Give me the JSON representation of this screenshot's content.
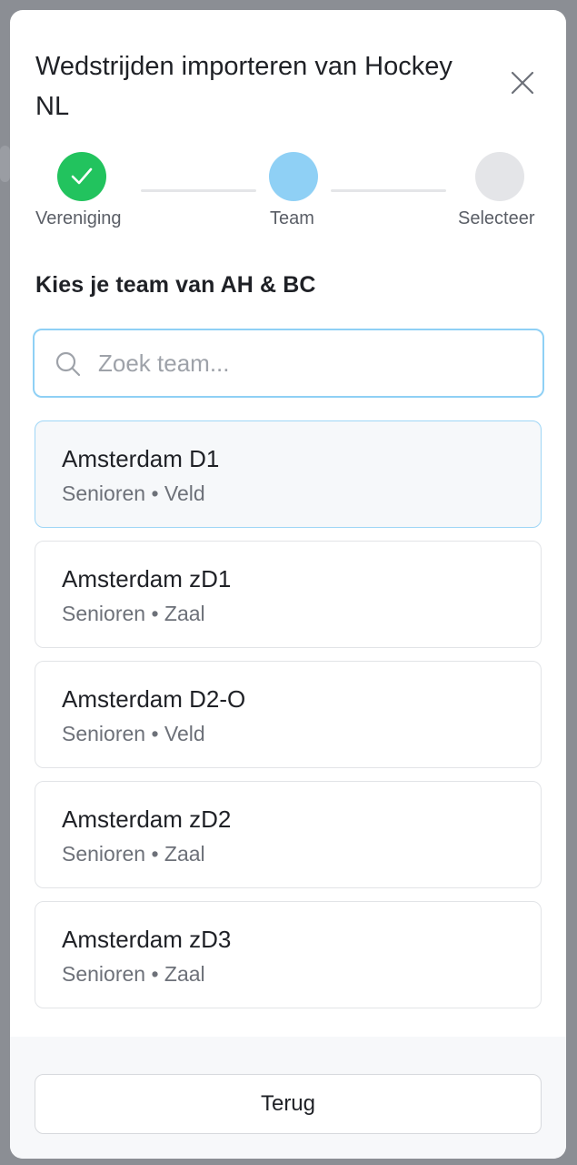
{
  "modal": {
    "title": "Wedstrijden importeren van Hockey NL",
    "close_icon": "close-icon"
  },
  "stepper": {
    "steps": [
      {
        "label": "Vereniging",
        "state": "completed",
        "icon": "check-icon",
        "color": "#22c35e"
      },
      {
        "label": "Team",
        "state": "active",
        "color": "#8fd0f5"
      },
      {
        "label": "Selecteer",
        "state": "pending",
        "color": "#e4e5e8"
      }
    ]
  },
  "section": {
    "heading": "Kies je team van AH & BC"
  },
  "search": {
    "placeholder": "Zoek team...",
    "value": "",
    "icon": "search-icon"
  },
  "teams": [
    {
      "name": "Amsterdam D1",
      "meta": "Senioren • Veld",
      "selected": true
    },
    {
      "name": "Amsterdam zD1",
      "meta": "Senioren • Zaal",
      "selected": false
    },
    {
      "name": "Amsterdam D2-O",
      "meta": "Senioren • Veld",
      "selected": false
    },
    {
      "name": "Amsterdam zD2",
      "meta": "Senioren • Zaal",
      "selected": false
    },
    {
      "name": "Amsterdam zD3",
      "meta": "Senioren • Zaal",
      "selected": false
    }
  ],
  "footer": {
    "back_label": "Terug"
  },
  "colors": {
    "accent": "#8fd0f5",
    "success": "#22c35e",
    "overlay": "#8b8e94"
  }
}
